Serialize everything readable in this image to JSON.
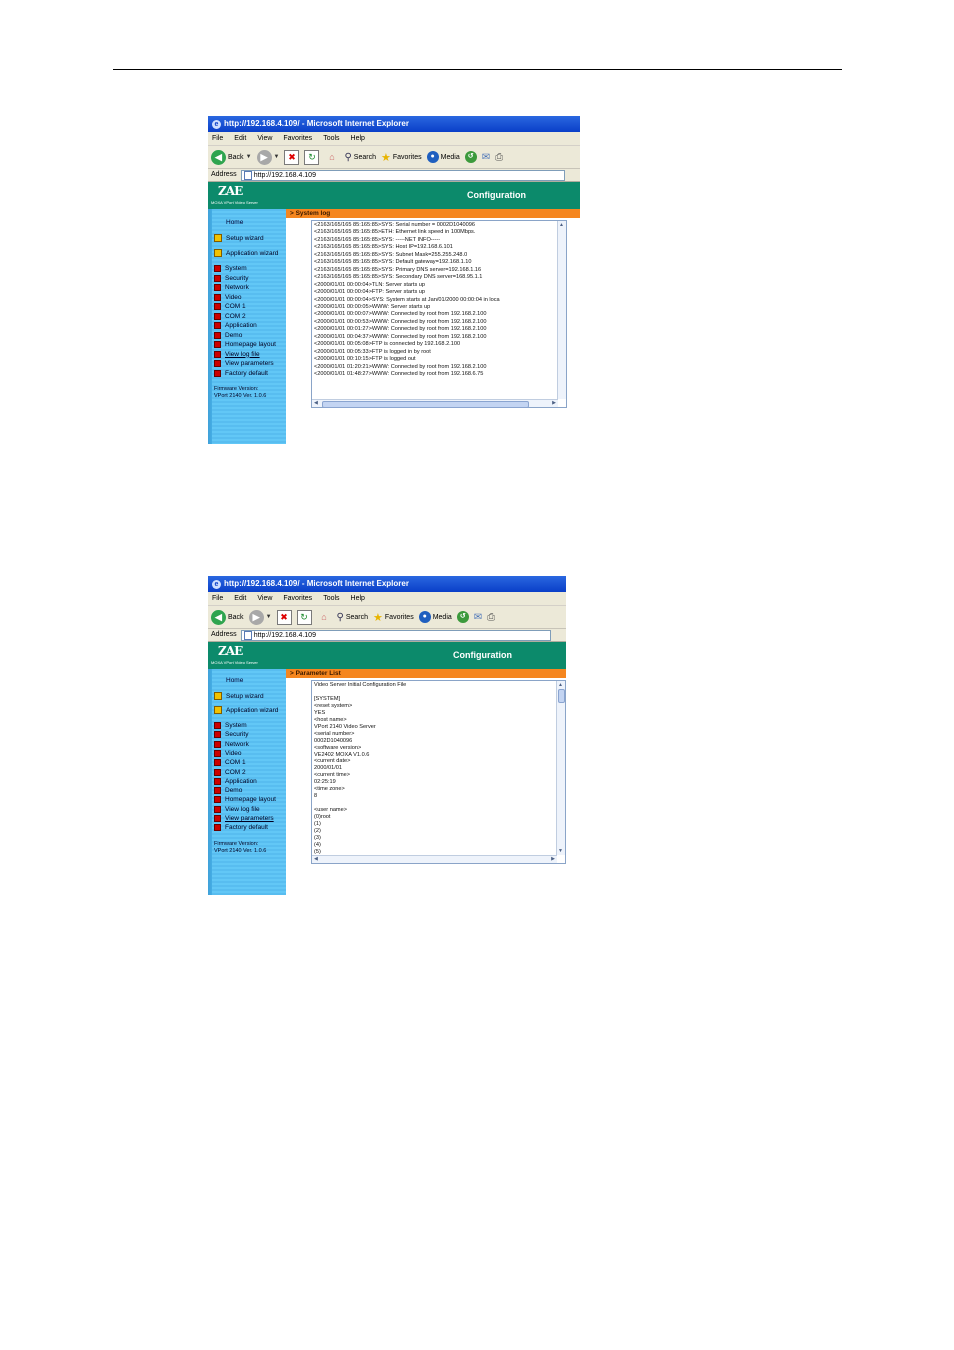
{
  "screenshot1": {
    "window_title": "http://192.168.4.109/ - Microsoft Internet Explorer",
    "menu": [
      "File",
      "Edit",
      "View",
      "Favorites",
      "Tools",
      "Help"
    ],
    "toolbar": {
      "back": "Back",
      "search": "Search",
      "favorites": "Favorites",
      "media": "Media"
    },
    "address_label": "Address",
    "address_value": "http://192.168.4.109",
    "logo_text": "ZAE",
    "logo_sub": "MOXA VPort Video Server",
    "header_title": "Configuration",
    "section_title": "> System log",
    "sidebar": {
      "home": "Home",
      "wizards": [
        "Setup wizard",
        "Application wizard"
      ],
      "items": [
        "System",
        "Security",
        "Network",
        "Video",
        "COM 1",
        "COM 2",
        "Application",
        "Demo",
        "Homepage layout",
        "View log file",
        "View parameters",
        "Factory default"
      ],
      "firmware_label": "Firmware Version:",
      "firmware_value": "VPort 2140 Ver. 1.0.6"
    },
    "log_lines": [
      "<2163/165/165 85:165:85>SYS: Serial number = 0002D1040096",
      "<2163/165/165 85:165:85>ETH: Ethernet link speed in 100Mbps.",
      "<2163/165/165 85:165:85>SYS: -----NET INFO-----",
      "<2163/165/165 85:165:85>SYS: Host IP=192.168.6.101",
      "<2163/165/165 85:165:85>SYS: Subnet Mask=255.255.248.0",
      "<2163/165/165 85:165:85>SYS: Default gateway=192.168.1.10",
      "<2163/165/165 85:165:85>SYS: Primary DNS server=192.168.1.16",
      "<2163/165/165 85:165:85>SYS: Secondary DNS server=168.95.1.1",
      "<2000/01/01 00:00:04>TLN: Server starts up",
      "<2000/01/01 00:00:04>FTP: Server starts up",
      "<2000/01/01 00:00:04>SYS: System starts at Jan/01/2000 00:00:04 in loca",
      "<2000/01/01 00:00:05>WWW: Server starts up",
      "<2000/01/01 00:00:07>WWW: Connected by root from 192.168.2.100",
      "<2000/01/01 00:00:53>WWW: Connected by root from 192.168.2.100",
      "<2000/01/01 00:01:27>WWW: Connected by root from 192.168.2.100",
      "<2000/01/01 00:04:37>WWW: Connected by root from 192.168.2.100",
      "<2000/01/01 00:05:08>FTP is connected by 192.168.2.100",
      "<2000/01/01 00:05:33>FTP is logged in by root",
      "<2000/01/01 00:10:15>FTP is logged out",
      "<2000/01/01 01:20:21>WWW: Connected by root from 192.168.2.100",
      "<2000/01/01 01:48:27>WWW: Connected by root from 192.168.6.75"
    ]
  },
  "screenshot2": {
    "window_title": "http://192.168.4.109/ - Microsoft Internet Explorer",
    "menu": [
      "File",
      "Edit",
      "View",
      "Favorites",
      "Tools",
      "Help"
    ],
    "toolbar": {
      "back": "Back",
      "search": "Search",
      "favorites": "Favorites",
      "media": "Media"
    },
    "address_label": "Address",
    "address_value": "http://192.168.4.109",
    "logo_text": "ZAE",
    "logo_sub": "MOXA VPort Video Server",
    "header_title": "Configuration",
    "section_title": "> Parameter List",
    "sidebar": {
      "home": "Home",
      "wizards": [
        "Setup wizard",
        "Application wizard"
      ],
      "items": [
        "System",
        "Security",
        "Network",
        "Video",
        "COM 1",
        "COM 2",
        "Application",
        "Demo",
        "Homepage layout",
        "View log file",
        "View parameters",
        "Factory default"
      ],
      "firmware_label": "Firmware Version:",
      "firmware_value": "VPort 2140 Ver. 1.0.6"
    },
    "param_lines": [
      "Video Server Initial Configuration File",
      "",
      "[SYSTEM]",
      "<reset system>",
      "YES",
      "<host name>",
      "VPort 2140 Video Server",
      "<serial number>",
      "0002D1040096",
      "<software version>",
      "VE2402 MOXA V1.0.6",
      "<current date>",
      "2000/01/01",
      "<current time>",
      "02:25:19",
      "<time zone>",
      "8",
      "",
      "<user name>",
      "(0)root",
      "(1)",
      "(2)",
      "(3)",
      "(4)",
      "(5)",
      "(6)"
    ]
  }
}
